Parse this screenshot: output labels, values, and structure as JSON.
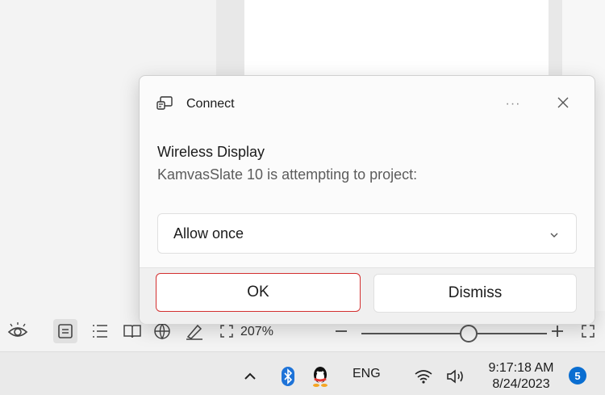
{
  "dialog": {
    "header_title": "Connect",
    "more_label": "···",
    "title": "Wireless Display",
    "message": "KamvasSlate 10 is attempting to project:",
    "selected_option": "Allow once",
    "ok_label": "OK",
    "dismiss_label": "Dismiss"
  },
  "statusbar": {
    "zoom_text": "207%"
  },
  "taskbar": {
    "language": "ENG",
    "time": "9:17:18 AM",
    "date": "8/24/2023",
    "notification_count": "5"
  },
  "colors": {
    "accent": "#0a6ed1",
    "ok_outline": "#d32f2f",
    "bluetooth": "#1e73d8"
  }
}
